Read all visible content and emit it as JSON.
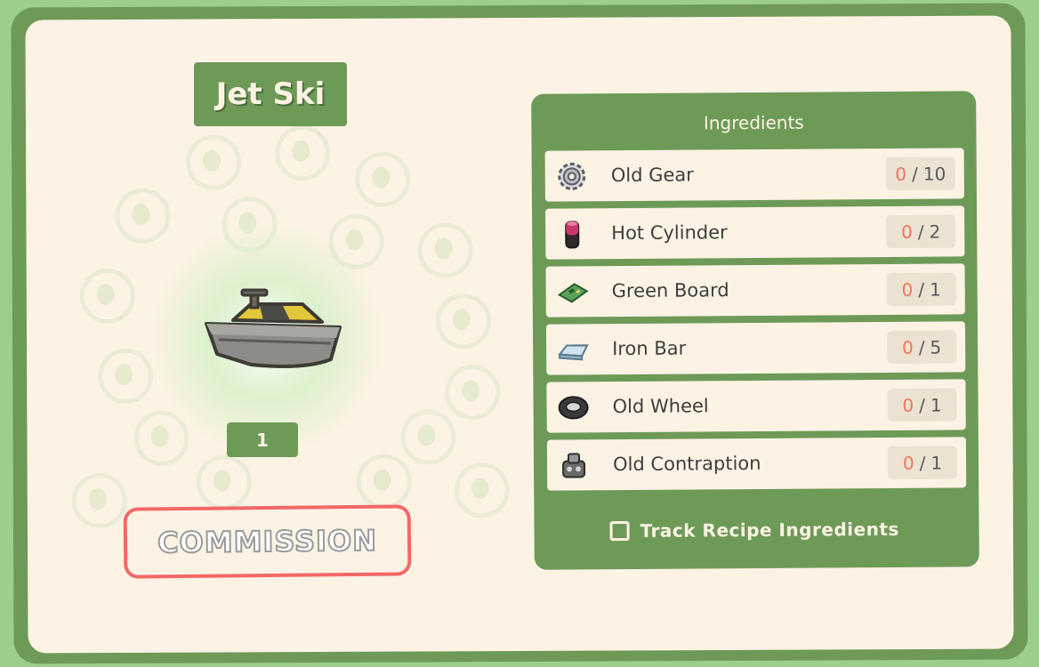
{
  "recipe": {
    "title": "Jet Ski",
    "quantity": "1",
    "item_icon": "jet-ski-icon"
  },
  "actions": {
    "commission_label": "COMMISSION"
  },
  "ingredients_panel": {
    "header": "Ingredients",
    "items": [
      {
        "name": "Old Gear",
        "have": "0",
        "need": "10",
        "icon": "old-gear-icon"
      },
      {
        "name": "Hot Cylinder",
        "have": "0",
        "need": "2",
        "icon": "hot-cylinder-icon"
      },
      {
        "name": "Green Board",
        "have": "0",
        "need": "1",
        "icon": "green-board-icon"
      },
      {
        "name": "Iron Bar",
        "have": "0",
        "need": "5",
        "icon": "iron-bar-icon"
      },
      {
        "name": "Old Wheel",
        "have": "0",
        "need": "1",
        "icon": "old-wheel-icon"
      },
      {
        "name": "Old Contraption",
        "have": "0",
        "need": "1",
        "icon": "old-contraption-icon"
      }
    ],
    "track_label": "Track Recipe Ingredients",
    "track_checked": false
  },
  "colors": {
    "frame_green": "#6e9a58",
    "panel_cream": "#fdf3e4",
    "commission_border": "#f36868",
    "count_have": "#f0785a"
  }
}
